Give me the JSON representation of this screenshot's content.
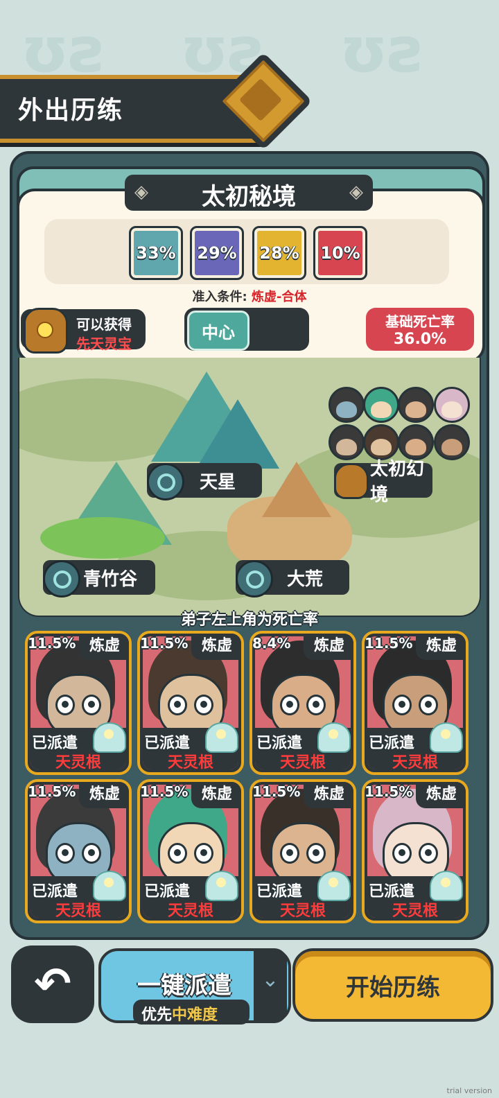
{
  "header": {
    "title": "外出历练"
  },
  "realm": {
    "name": "太初秘境",
    "percentages": [
      {
        "value": "33%",
        "color": "#5fa7ad"
      },
      {
        "value": "29%",
        "color": "#6a66b8"
      },
      {
        "value": "28%",
        "color": "#e2b42f"
      },
      {
        "value": "10%",
        "color": "#d64550"
      }
    ],
    "condition_label": "准入条件:",
    "condition_value": "炼虚-合体",
    "reward_line1": "可以获得",
    "reward_line2": "先天灵宝",
    "region_button": "中心",
    "death_label": "基础死亡率",
    "death_value": "36.0%"
  },
  "map": {
    "locations": [
      {
        "name": "天星"
      },
      {
        "name": "大荒"
      },
      {
        "name": "青竹谷"
      },
      {
        "name": "太初幻境"
      }
    ]
  },
  "hint": "弟子左上角为死亡率",
  "disciples": [
    {
      "rate": "11.5%",
      "rank": "炼虚",
      "status": "已派遣",
      "root": "天灵根",
      "hair": "#333333",
      "skin": "#d3b79b"
    },
    {
      "rate": "11.5%",
      "rank": "炼虚",
      "status": "已派遣",
      "root": "天灵根",
      "hair": "#4a3a30",
      "skin": "#e0c19e"
    },
    {
      "rate": "8.4%",
      "rank": "炼虚",
      "status": "已派遣",
      "root": "天灵根",
      "hair": "#2d2d2d",
      "skin": "#d9ad88"
    },
    {
      "rate": "11.5%",
      "rank": "炼虚",
      "status": "已派遣",
      "root": "天灵根",
      "hair": "#2b2b2b",
      "skin": "#c99e7a"
    },
    {
      "rate": "11.5%",
      "rank": "炼虚",
      "status": "已派遣",
      "root": "天灵根",
      "hair": "#3b3b3b",
      "skin": "#8fb2c2"
    },
    {
      "rate": "11.5%",
      "rank": "炼虚",
      "status": "已派遣",
      "root": "天灵根",
      "hair": "#3ea889",
      "skin": "#f2d7b6"
    },
    {
      "rate": "11.5%",
      "rank": "炼虚",
      "status": "已派遣",
      "root": "天灵根",
      "hair": "#3a302a",
      "skin": "#dcb48f"
    },
    {
      "rate": "11.5%",
      "rank": "炼虚",
      "status": "已派遣",
      "root": "天灵根",
      "hair": "#d8b8c8",
      "skin": "#f5e1d1"
    }
  ],
  "bottom": {
    "dispatch_label": "一键派遣",
    "dispatch_sub_prefix": "优先",
    "dispatch_sub_highlight": "中难度",
    "start_label": "开始历练"
  },
  "watermark": "trial version"
}
